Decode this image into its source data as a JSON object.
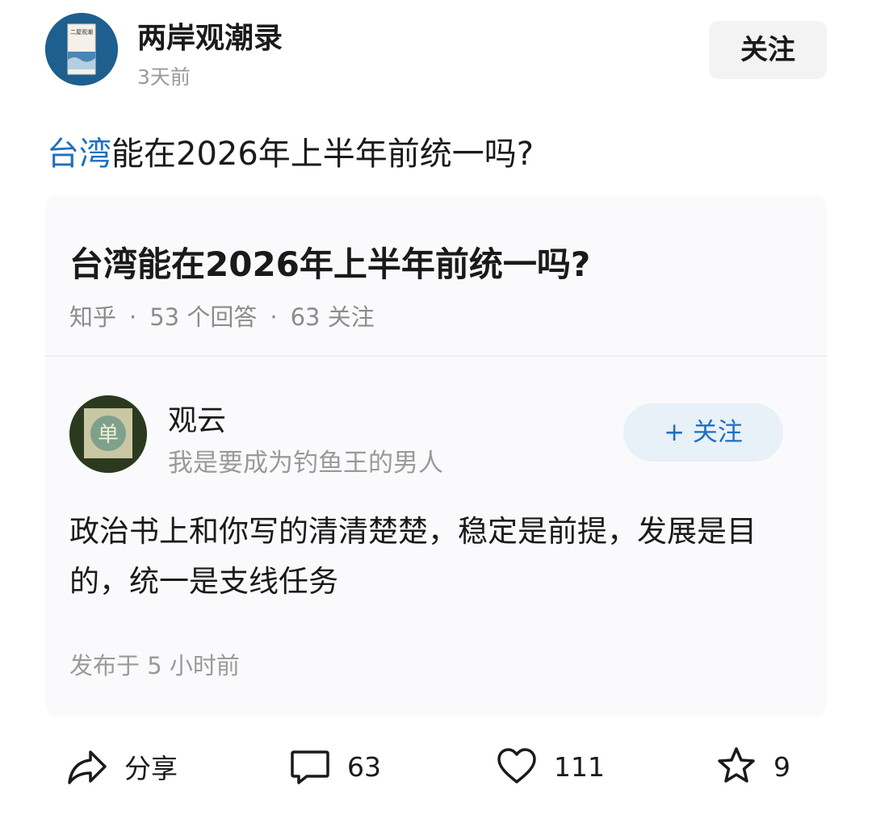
{
  "author": {
    "name": "两岸观潮录",
    "time": "3天前",
    "follow_label": "关注",
    "avatar_text": "二屋观潮"
  },
  "post": {
    "topic": "台湾",
    "title_rest": "能在2026年上半年前统一吗?"
  },
  "card": {
    "question_title": "台湾能在2026年上半年前统一吗?",
    "source": "知乎",
    "answers": "53 个回答",
    "followers": "63 关注",
    "separator": "·",
    "answerer": {
      "name": "观云",
      "bio": "我是要成为钓鱼王的男人",
      "follow_label": "+ 关注",
      "avatar_char": "单"
    },
    "answer_text": "政治书上和你写的清清楚楚，稳定是前提，发展是目的，统一是支线任务",
    "published": "发布于 5 小时前"
  },
  "actions": {
    "share_label": "分享",
    "comments": "63",
    "likes": "111",
    "favorites": "9"
  },
  "colors": {
    "accent": "#1f6fbf",
    "follow_bg": "#e8f0f8"
  }
}
